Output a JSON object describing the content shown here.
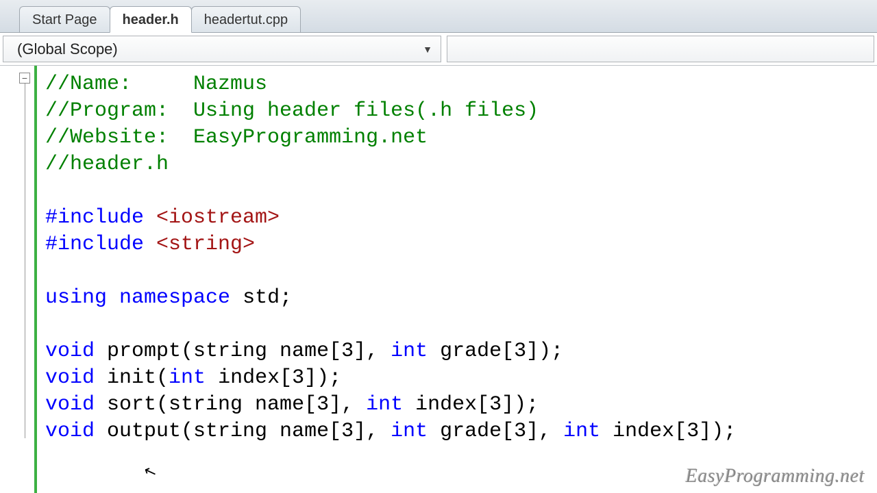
{
  "tabs": [
    {
      "label": "Start Page",
      "active": false
    },
    {
      "label": "header.h",
      "active": true
    },
    {
      "label": "headertut.cpp",
      "active": false
    }
  ],
  "scope": {
    "selected": "(Global Scope)"
  },
  "fold": {
    "symbol": "−"
  },
  "code": {
    "l1": "//Name:     Nazmus",
    "l2": "//Program:  Using header files(.h files)",
    "l3": "//Website:  EasyProgramming.net",
    "l4": "//header.h",
    "l5": "",
    "l6a": "#include ",
    "l6b": "<iostream>",
    "l7a": "#include ",
    "l7b": "<string>",
    "l8": "",
    "l9a": "using",
    "l9b": " ",
    "l9c": "namespace",
    "l9d": " std;",
    "l10": "",
    "l11a": "void",
    "l11b": " prompt(string name[3], ",
    "l11c": "int",
    "l11d": " grade[3]);",
    "l12a": "void",
    "l12b": " init(",
    "l12c": "int",
    "l12d": " index[3]);",
    "l13a": "void",
    "l13b": " sort(string name[3], ",
    "l13c": "int",
    "l13d": " index[3]);",
    "l14a": "void",
    "l14b": " output(string name[3], ",
    "l14c": "int",
    "l14d": " grade[3], ",
    "l14e": "int",
    "l14f": " index[3]);"
  },
  "watermark": "EasyProgramming.net"
}
